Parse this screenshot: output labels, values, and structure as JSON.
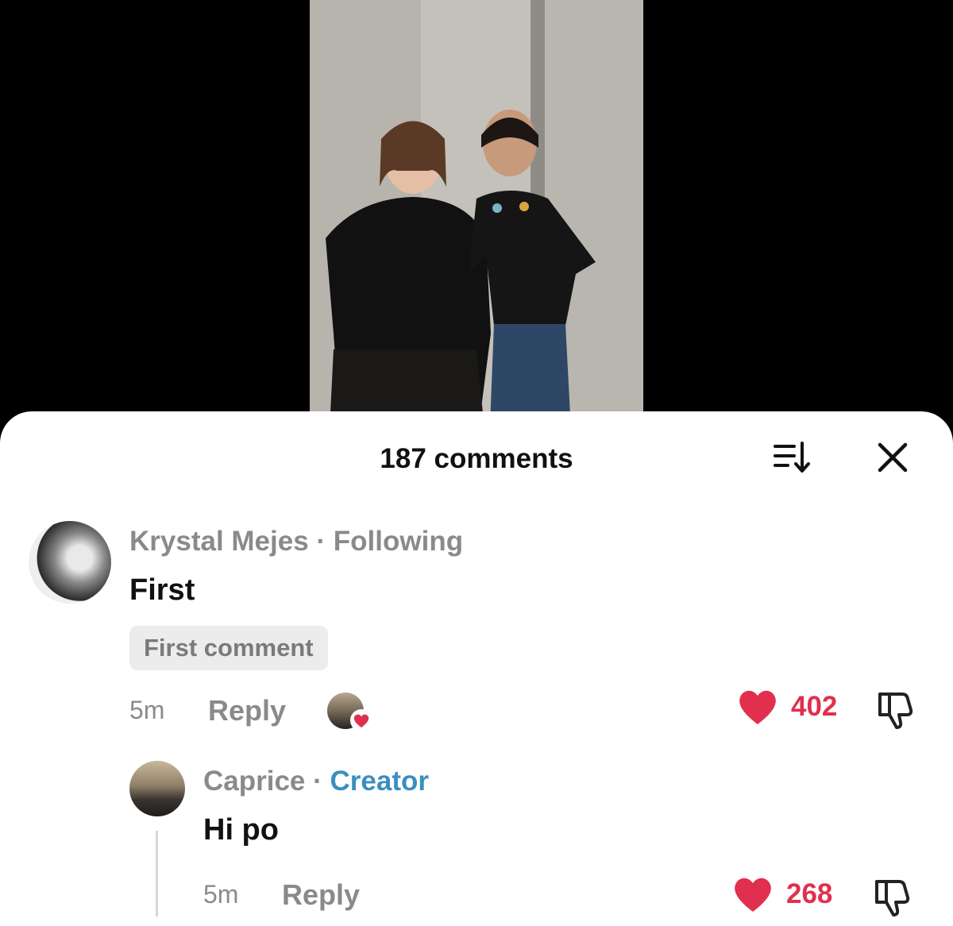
{
  "sheet": {
    "comment_count_label": "187 comments",
    "sort_icon": "sort-icon",
    "close_icon": "close-icon"
  },
  "comments": [
    {
      "author": "Krystal Mejes",
      "relationship": "Following",
      "text": "First",
      "badge": "First comment",
      "time": "5m",
      "reply_label": "Reply",
      "likes": "402",
      "liked_by_creator": true
    },
    {
      "author": "Caprice",
      "relationship": "Creator",
      "text": "Hi po",
      "time": "5m",
      "reply_label": "Reply",
      "likes": "268"
    }
  ],
  "colors": {
    "like": "#e0304d",
    "creator_tag": "#3b8fc0",
    "muted_text": "#8a8a8a"
  }
}
